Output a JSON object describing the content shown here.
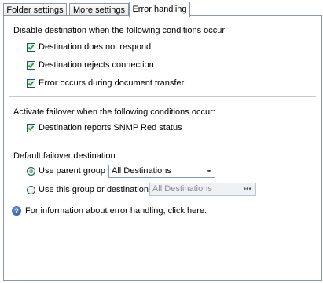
{
  "tabs": [
    {
      "label": "Folder settings",
      "active": false
    },
    {
      "label": "More settings",
      "active": false
    },
    {
      "label": "Error handling",
      "active": true
    }
  ],
  "disable_section": {
    "title": "Disable destination when the following conditions occur:",
    "options": [
      {
        "label": "Destination does not respond",
        "checked": true
      },
      {
        "label": "Destination rejects connection",
        "checked": true
      },
      {
        "label": "Error occurs during document transfer",
        "checked": true
      }
    ]
  },
  "failover_section": {
    "title": "Activate failover when the following conditions occur:",
    "options": [
      {
        "label": "Destination reports SNMP Red status",
        "checked": true
      }
    ]
  },
  "default_failover": {
    "title": "Default failover destination:",
    "use_parent_label": "Use parent group",
    "use_parent_selected": true,
    "parent_group_value": "All Destinations",
    "use_this_label": "Use this group or destination",
    "use_this_selected": false,
    "this_group_value": "All Destinations",
    "browse_label": "•••"
  },
  "help": {
    "icon": "help-icon",
    "text": "For information about error handling, click here."
  },
  "colors": {
    "tab_border": "#8a97a8",
    "checkbox_border": "#1c5180",
    "check_mark": "#21a121",
    "radio_dot": "#1b8a1b",
    "help_icon": "#214f9e",
    "disabled_text": "#8c8c8c"
  }
}
